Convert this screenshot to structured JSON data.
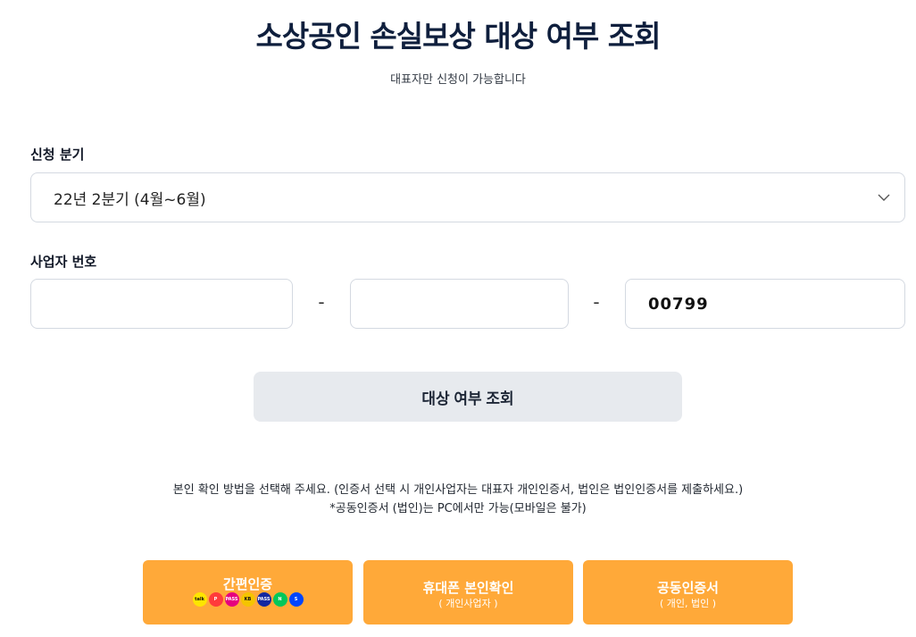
{
  "header": {
    "title": "소상공인 손실보상 대상 여부 조회",
    "subtitle": "대표자만 신청이 가능합니다"
  },
  "quarter": {
    "label": "신청 분기",
    "selected": "22년 2분기 (4월~6월)"
  },
  "business_number": {
    "label": "사업자 번호",
    "part1": "",
    "separator1": "-",
    "part2": "",
    "separator2": "-",
    "part3": "00799"
  },
  "check_button": {
    "label": "대상 여부 조회"
  },
  "notice": {
    "line1": "본인 확인 방법을 선택해 주세요. (인증서 선택 시 개인사업자는 대표자 개인인증서, 법인은 법인인증서를 제출하세요.)",
    "line2": "*공동인증서 (법인)는 PC에서만 가능(모바일은 불가)"
  },
  "auth_options": [
    {
      "title": "간편인증",
      "providers": [
        {
          "icon": "kakao-icon",
          "text": "talk",
          "color": "#fee500"
        },
        {
          "icon": "payco-icon",
          "text": "P",
          "color": "#ff3b3b"
        },
        {
          "icon": "pass-icon",
          "text": "PASS",
          "color": "#e6007e"
        },
        {
          "icon": "kb-icon",
          "text": "KB",
          "color": "#f5c400"
        },
        {
          "icon": "samsung-pass-icon",
          "text": "PASS",
          "color": "#1428a0"
        },
        {
          "icon": "naver-icon",
          "text": "N",
          "color": "#03c75a"
        },
        {
          "icon": "shinhan-icon",
          "text": "S",
          "color": "#0046ff"
        }
      ]
    },
    {
      "title": "휴대폰 본인확인",
      "subtitle": "( 개인사업자 )"
    },
    {
      "title": "공동인증서",
      "subtitle": "( 개인, 법인 )"
    }
  ],
  "colors": {
    "accent": "#ffa939",
    "title": "#0f1f3d",
    "check_button_bg": "#e7eaee",
    "border": "#d4d9e1"
  }
}
